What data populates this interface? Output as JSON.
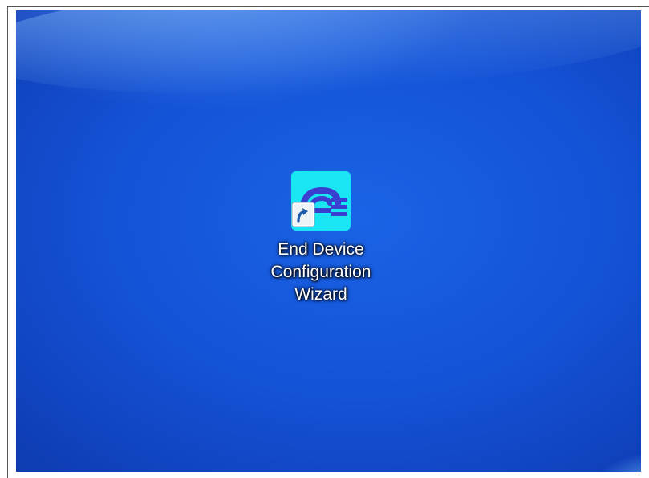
{
  "desktop": {
    "background_color": "#1452d6",
    "shortcut": {
      "label_lines": [
        "End Device",
        "Configuration",
        "Wizard"
      ],
      "icon": "end-device-wizard-app-icon",
      "overlay_icon": "shortcut-arrow-icon",
      "icon_colors": {
        "background": "#19e6f2",
        "glyph": "#3a3fd0"
      }
    }
  }
}
